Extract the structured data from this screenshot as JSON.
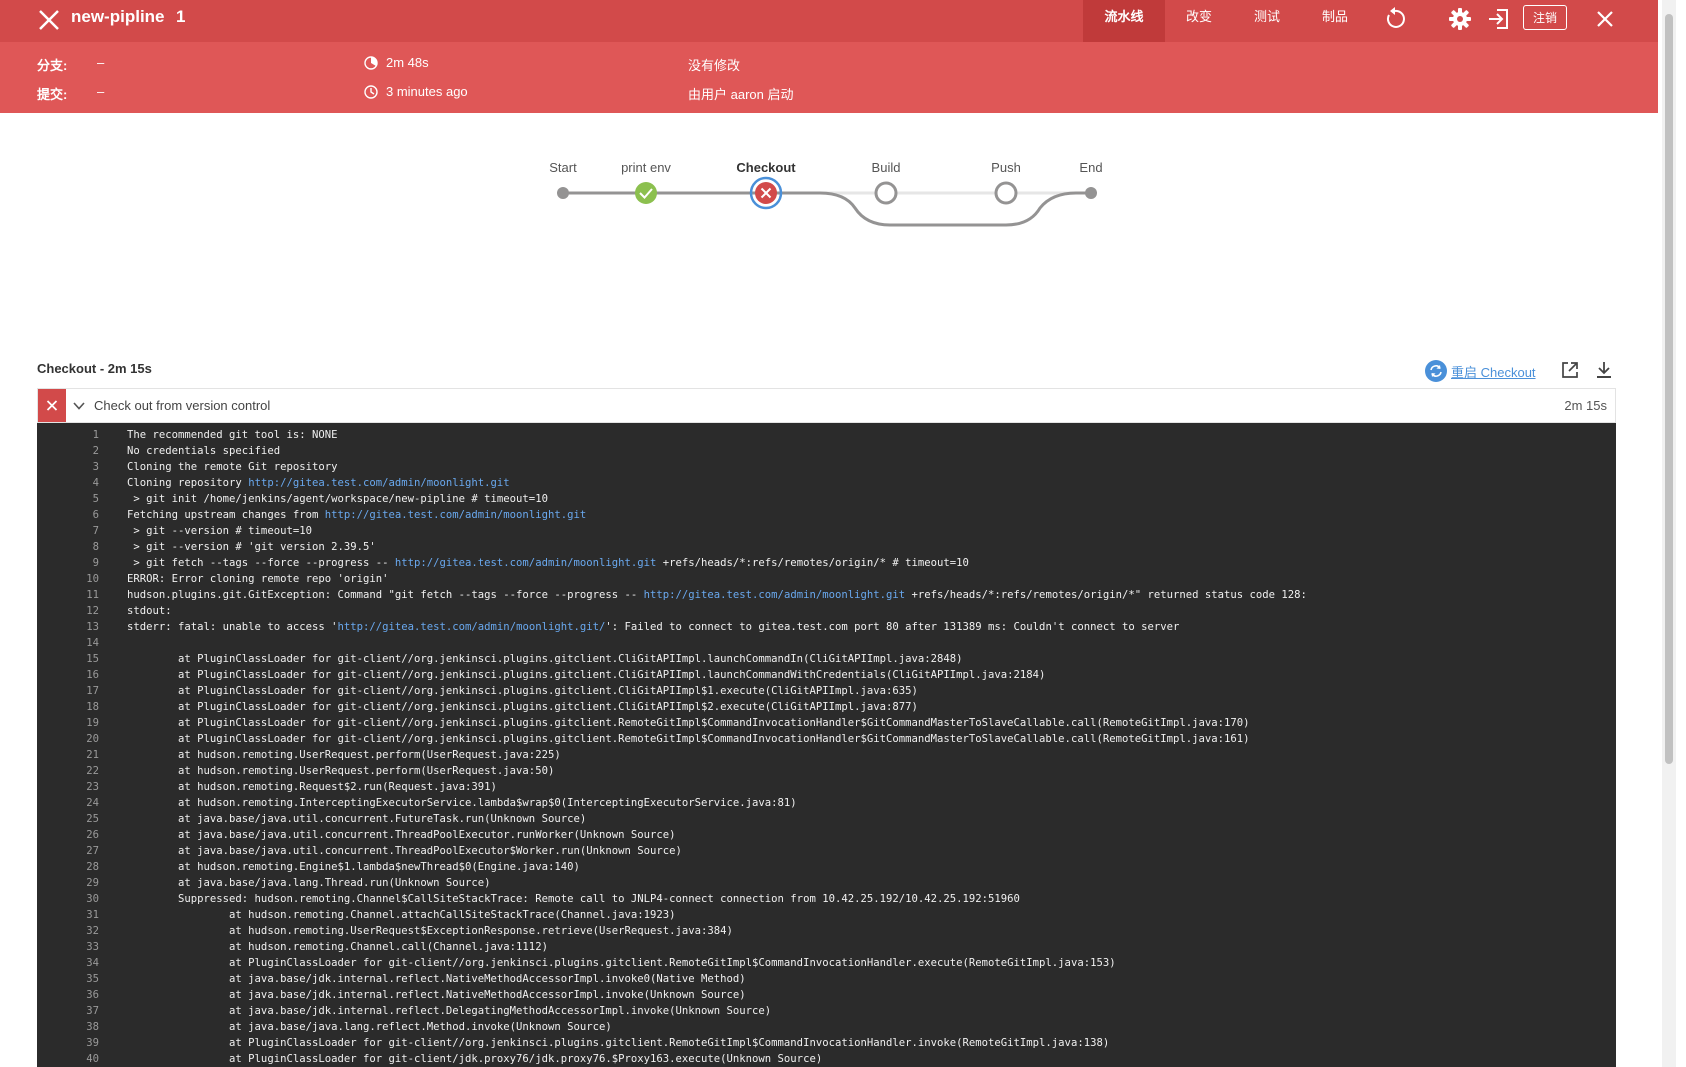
{
  "header": {
    "title": "new-pipline",
    "run_number": "1",
    "tabs": [
      "流水线",
      "改变",
      "测试",
      "制品"
    ],
    "logout_label": "注销",
    "icons": [
      "close-icon",
      "replay-icon",
      "gear-icon",
      "exit-icon",
      "close-icon"
    ]
  },
  "info": {
    "branch_label": "分支:",
    "branch_value": "–",
    "commit_label": "提交:",
    "commit_value": "–",
    "duration": "2m 48s",
    "started": "3 minutes ago",
    "changes": "没有修改",
    "started_by": "由用户 aaron 启动"
  },
  "pipeline": {
    "stages": [
      {
        "name": "Start",
        "status": "start"
      },
      {
        "name": "print env",
        "status": "success"
      },
      {
        "name": "Checkout",
        "status": "failed"
      },
      {
        "name": "Build",
        "status": "not-built"
      },
      {
        "name": "Push",
        "status": "not-built"
      },
      {
        "name": "End",
        "status": "end"
      }
    ],
    "colors": {
      "success": "#8cc04f",
      "failed": "#d24a4a",
      "selected_ring": "#4a90d9",
      "line": "#949393"
    }
  },
  "step": {
    "title": "Checkout - 2m 15s",
    "restart_label": "重启 Checkout",
    "row_label": "Check out from version control",
    "row_duration": "2m 15s"
  },
  "log": [
    {
      "text": "The recommended git tool is: NONE"
    },
    {
      "text": "No credentials specified"
    },
    {
      "text": "Cloning the remote Git repository"
    },
    {
      "text": "Cloning repository ",
      "link": "http://gitea.test.com/admin/moonlight.git",
      "after": ""
    },
    {
      "text": " > git init /home/jenkins/agent/workspace/new-pipline # timeout=10"
    },
    {
      "text": "Fetching upstream changes from ",
      "link": "http://gitea.test.com/admin/moonlight.git",
      "after": ""
    },
    {
      "text": " > git --version # timeout=10"
    },
    {
      "text": " > git --version # 'git version 2.39.5'"
    },
    {
      "text": " > git fetch --tags --force --progress -- ",
      "link": "http://gitea.test.com/admin/moonlight.git",
      "after": " +refs/heads/*:refs/remotes/origin/* # timeout=10"
    },
    {
      "text": "ERROR: Error cloning remote repo 'origin'"
    },
    {
      "text": "hudson.plugins.git.GitException: Command \"git fetch --tags --force --progress -- ",
      "link": "http://gitea.test.com/admin/moonlight.git",
      "after": " +refs/heads/*:refs/remotes/origin/*\" returned status code 128:"
    },
    {
      "text": "stdout:"
    },
    {
      "text": "stderr: fatal: unable to access '",
      "link": "http://gitea.test.com/admin/moonlight.git/",
      "after": "': Failed to connect to gitea.test.com port 80 after 131389 ms: Couldn't connect to server"
    },
    {
      "text": ""
    },
    {
      "text": "        at PluginClassLoader for git-client//org.jenkinsci.plugins.gitclient.CliGitAPIImpl.launchCommandIn(CliGitAPIImpl.java:2848)"
    },
    {
      "text": "        at PluginClassLoader for git-client//org.jenkinsci.plugins.gitclient.CliGitAPIImpl.launchCommandWithCredentials(CliGitAPIImpl.java:2184)"
    },
    {
      "text": "        at PluginClassLoader for git-client//org.jenkinsci.plugins.gitclient.CliGitAPIImpl$1.execute(CliGitAPIImpl.java:635)"
    },
    {
      "text": "        at PluginClassLoader for git-client//org.jenkinsci.plugins.gitclient.CliGitAPIImpl$2.execute(CliGitAPIImpl.java:877)"
    },
    {
      "text": "        at PluginClassLoader for git-client//org.jenkinsci.plugins.gitclient.RemoteGitImpl$CommandInvocationHandler$GitCommandMasterToSlaveCallable.call(RemoteGitImpl.java:170)"
    },
    {
      "text": "        at PluginClassLoader for git-client//org.jenkinsci.plugins.gitclient.RemoteGitImpl$CommandInvocationHandler$GitCommandMasterToSlaveCallable.call(RemoteGitImpl.java:161)"
    },
    {
      "text": "        at hudson.remoting.UserRequest.perform(UserRequest.java:225)"
    },
    {
      "text": "        at hudson.remoting.UserRequest.perform(UserRequest.java:50)"
    },
    {
      "text": "        at hudson.remoting.Request$2.run(Request.java:391)"
    },
    {
      "text": "        at hudson.remoting.InterceptingExecutorService.lambda$wrap$0(InterceptingExecutorService.java:81)"
    },
    {
      "text": "        at java.base/java.util.concurrent.FutureTask.run(Unknown Source)"
    },
    {
      "text": "        at java.base/java.util.concurrent.ThreadPoolExecutor.runWorker(Unknown Source)"
    },
    {
      "text": "        at java.base/java.util.concurrent.ThreadPoolExecutor$Worker.run(Unknown Source)"
    },
    {
      "text": "        at hudson.remoting.Engine$1.lambda$newThread$0(Engine.java:140)"
    },
    {
      "text": "        at java.base/java.lang.Thread.run(Unknown Source)"
    },
    {
      "text": "        Suppressed: hudson.remoting.Channel$CallSiteStackTrace: Remote call to JNLP4-connect connection from 10.42.25.192/10.42.25.192:51960"
    },
    {
      "text": "                at hudson.remoting.Channel.attachCallSiteStackTrace(Channel.java:1923)"
    },
    {
      "text": "                at hudson.remoting.UserRequest$ExceptionResponse.retrieve(UserRequest.java:384)"
    },
    {
      "text": "                at hudson.remoting.Channel.call(Channel.java:1112)"
    },
    {
      "text": "                at PluginClassLoader for git-client//org.jenkinsci.plugins.gitclient.RemoteGitImpl$CommandInvocationHandler.execute(RemoteGitImpl.java:153)"
    },
    {
      "text": "                at java.base/jdk.internal.reflect.NativeMethodAccessorImpl.invoke0(Native Method)"
    },
    {
      "text": "                at java.base/jdk.internal.reflect.NativeMethodAccessorImpl.invoke(Unknown Source)"
    },
    {
      "text": "                at java.base/jdk.internal.reflect.DelegatingMethodAccessorImpl.invoke(Unknown Source)"
    },
    {
      "text": "                at java.base/java.lang.reflect.Method.invoke(Unknown Source)"
    },
    {
      "text": "                at PluginClassLoader for git-client//org.jenkinsci.plugins.gitclient.RemoteGitImpl$CommandInvocationHandler.invoke(RemoteGitImpl.java:138)"
    },
    {
      "text": "                at PluginClassLoader for git-client/jdk.proxy76/jdk.proxy76.$Proxy163.execute(Unknown Source)"
    }
  ]
}
